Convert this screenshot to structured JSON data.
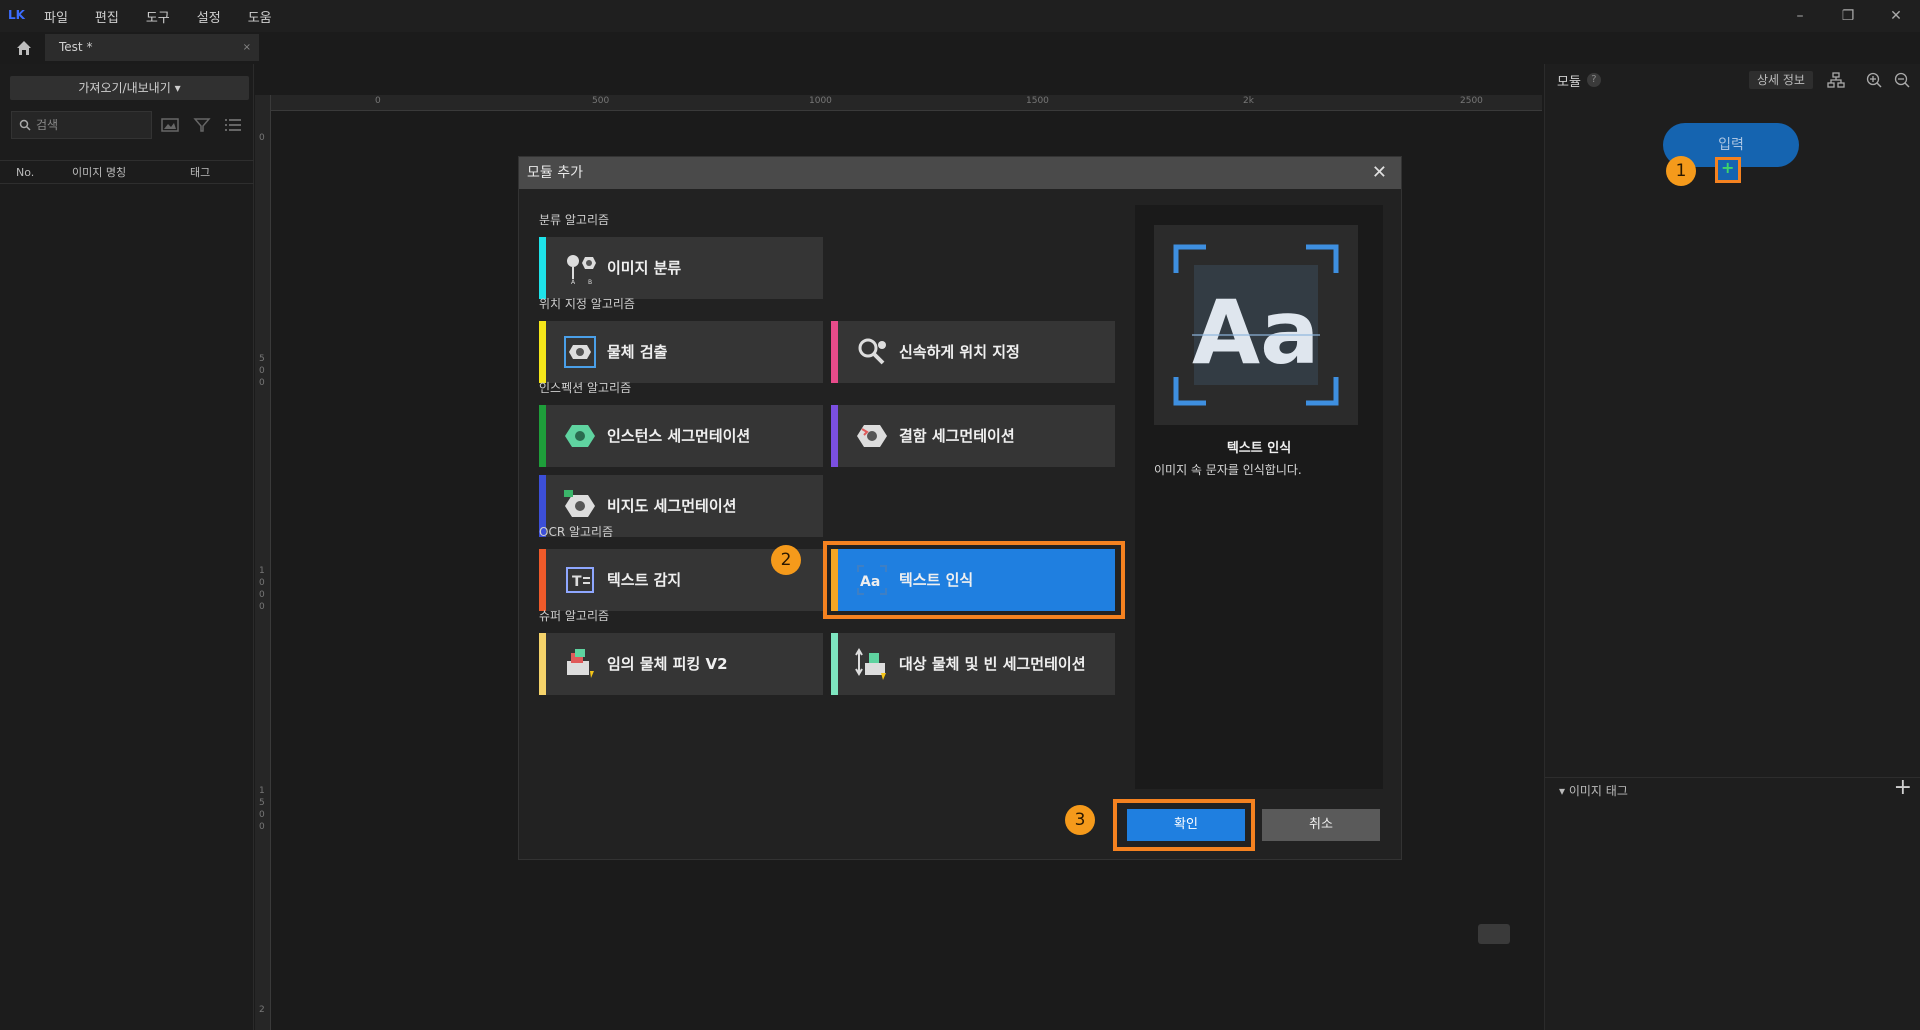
{
  "app": {
    "logo": "LK",
    "menu": [
      "파일",
      "편집",
      "도구",
      "설정",
      "도움"
    ]
  },
  "window_controls": {
    "minimize": "–",
    "restore": "❐",
    "close": "✕"
  },
  "tab": {
    "label": "Test *",
    "close": "×"
  },
  "left_panel": {
    "import_export": "가져오기/내보내기 ▾",
    "search_placeholder": "검색",
    "columns": {
      "no": "No.",
      "image_name": "이미지 명칭",
      "tag": "태그"
    }
  },
  "ruler": {
    "h_labels": [
      "0",
      "500",
      "1000",
      "1500",
      "2k",
      "2500"
    ],
    "v_labels": [
      "0",
      "5\n0\n0",
      "1\n0\n0\n0",
      "1\n5\n0\n0",
      "2"
    ]
  },
  "right_panel": {
    "title": "모듈",
    "help": "?",
    "detail_button": "상세 정보",
    "input_node": "입력",
    "image_tag_section": "▾ 이미지 태그",
    "add": "+"
  },
  "dialog": {
    "title": "모듈 추가",
    "close": "✕",
    "sections": {
      "classification": "분류 알고리즘",
      "localization": "위치 지정 알고리즘",
      "inspection": "인스펙션 알고리즘",
      "ocr": "OCR 알고리즘",
      "super": "슈퍼 알고리즘"
    },
    "algorithms": {
      "image_classification": {
        "label": "이미지 분류",
        "color": "#1ee3ea"
      },
      "object_detection": {
        "label": "물체 검출",
        "color": "#f5e61a"
      },
      "fast_positioning": {
        "label": "신속하게 위치 지정",
        "color": "#e84b8a"
      },
      "instance_segmentation": {
        "label": "인스턴스 세그먼테이션",
        "color": "#1e9e3a"
      },
      "defect_segmentation": {
        "label": "결함 세그먼테이션",
        "color": "#7b4fe0"
      },
      "unsupervised_segmentation": {
        "label": "비지도 세그먼테이션",
        "color": "#3c4fd8"
      },
      "text_detection": {
        "label": "텍스트 감지",
        "color": "#ef5a2a"
      },
      "text_recognition": {
        "label": "텍스트 인식",
        "color": "#f5a623"
      },
      "random_picking": {
        "label": "임의 물체 피킹 V2",
        "color": "#f5d36a"
      },
      "target_bin_segmentation": {
        "label": "대상 물체 및 빈 세그먼테이션",
        "color": "#7ee6c0"
      }
    },
    "preview": {
      "name": "텍스트 인식",
      "description": "이미지 속 문자를 인식합니다."
    },
    "ok": "확인",
    "cancel": "취소"
  },
  "callouts": [
    "1",
    "2",
    "3"
  ],
  "colors": {
    "accent": "#1f7fe0",
    "callout": "#f59a1b",
    "highlight": "#f58220"
  }
}
